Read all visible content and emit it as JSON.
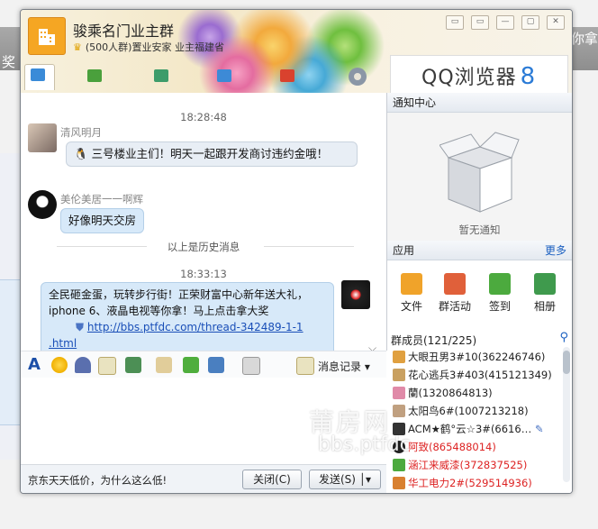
{
  "background": {
    "left_text": "奖",
    "right_text": "你拿"
  },
  "window": {
    "group_name": "骏乘名门业主群",
    "group_info": "(500人群)置业安家 业主福建省",
    "controls": [
      "▭",
      "▭",
      "—",
      "▢",
      "✕"
    ]
  },
  "tabs": [
    {
      "label": "聊天",
      "icon": "chat-icon",
      "color": "#3a8bd8"
    },
    {
      "label": "公告",
      "icon": "announcement-icon",
      "color": "#4aa03c"
    },
    {
      "label": "相册",
      "icon": "album-icon",
      "color": "#3d9c6a"
    },
    {
      "label": "文件",
      "icon": "folder-icon",
      "color": "#3d8ad6"
    },
    {
      "label": "活动",
      "icon": "flag-icon",
      "color": "#d9422e"
    }
  ],
  "ad_banner": {
    "text": "QQ浏览器",
    "suffix": "8"
  },
  "chat": {
    "messages": [
      {
        "time": "18:28:48",
        "sender": "清风明月",
        "text": "三号楼业主们！明天一起跟开发商讨违约金哦！"
      },
      {
        "sender": "美伦美居一一啊辉",
        "text": "好像明天交房"
      },
      {
        "history_label": "以上是历史消息"
      },
      {
        "time": "18:33:13",
        "line1": "全民砸金蛋，玩转步行街！正荣财富中心新年送大礼，",
        "line2": "iphone 6、液晶电视等你拿！马上点击拿大奖",
        "link": "http://bbs.ptfdc.com/thread-342489-1-1",
        "link2": ".html"
      }
    ]
  },
  "toolbar": {
    "message_record": "消息记录"
  },
  "footer": {
    "ad": "京东天天低价，为什么这么低!",
    "close_label": "关闭(C)",
    "send_label": "发送(S)"
  },
  "side": {
    "notice_title": "通知中心",
    "notice_empty": "暂无通知",
    "apps_title": "应用",
    "apps_more": "更多",
    "apps": [
      {
        "label": "文件",
        "color": "#f0a32a"
      },
      {
        "label": "群活动",
        "color": "#e0603a"
      },
      {
        "label": "签到",
        "color": "#4caa3e"
      },
      {
        "label": "相册",
        "color": "#3f9a4d"
      }
    ],
    "members_title": "群成员(121/225)",
    "members": [
      {
        "name": "大眼丑男3#10(362246746)",
        "color": "#222"
      },
      {
        "name": "花心逃兵3#403(415121349)",
        "color": "#222"
      },
      {
        "name": "蘭(1320864813)",
        "color": "#222"
      },
      {
        "name": "太阳鸟6#(1007213218)",
        "color": "#222"
      },
      {
        "name": "ACM★鹤°云☆3#(6616…",
        "color": "#222"
      },
      {
        "name": "阿致(865488014)",
        "color": "#d22"
      },
      {
        "name": "涵江来威漆(372837525)",
        "color": "#d22"
      },
      {
        "name": "华工电力2#(529514936)",
        "color": "#d22"
      }
    ]
  },
  "watermark": {
    "line1": "莆房网",
    "line2": "bbs.ptfdc"
  }
}
